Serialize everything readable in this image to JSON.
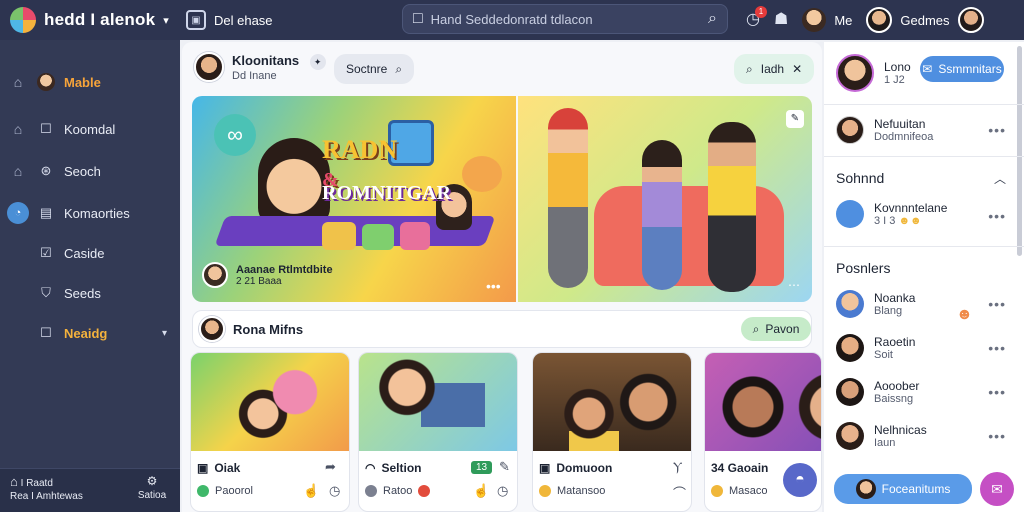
{
  "app": {
    "title": "hedd I alenok",
    "tab_label": "Del ehase",
    "search_placeholder": "Hand Seddedonratd tdlacon",
    "notification_count": "1",
    "user_short": "Me",
    "user_name": "Gedmes"
  },
  "sidebar": {
    "items": [
      {
        "label": "Mable",
        "icon": "avatar-icon",
        "lead": "home-icon"
      },
      {
        "label": "Koomdal",
        "icon": "square-icon",
        "lead": "home-icon"
      },
      {
        "label": "Seoch",
        "icon": "globe-icon",
        "lead": "car-icon"
      },
      {
        "label": "Komaorties",
        "icon": "grid-icon",
        "lead": "bubble-icon"
      },
      {
        "label": "Caside",
        "icon": "check-square-icon"
      },
      {
        "label": "Seeds",
        "icon": "shield-icon"
      },
      {
        "label": "Neaidg",
        "icon": "square-icon"
      }
    ],
    "bottom": [
      {
        "icon": "home-icon",
        "line1": "I Raatd",
        "line2": "Rea I Amhtewas"
      },
      {
        "icon": "gear-icon",
        "line1": "",
        "line2": "Satioa"
      }
    ]
  },
  "main": {
    "header": {
      "title": "Kloonitans",
      "subtitle": "Dd Inane",
      "sort_label": "Soctnre",
      "filter_label": "Iadh"
    },
    "hero": {
      "title_line1": "RADN",
      "title_amp": "&",
      "title_line2": "ROMNITGAR",
      "caption_name": "Aaanae Rtlmtdbite",
      "caption_sub": "2 21 Baaa"
    },
    "section": {
      "title": "Rona Mifns",
      "button_label": "Pavon"
    },
    "cards": [
      {
        "title": "Oiak",
        "sub": "Paoorol"
      },
      {
        "title": "Seltion",
        "sub": "Ratoo",
        "badge": "13"
      },
      {
        "title": "Domuoon",
        "sub": "Matansoo"
      },
      {
        "title": "34 Gaoain",
        "sub": "Masaco"
      }
    ]
  },
  "right": {
    "profile": {
      "name": "Lono",
      "sub": "1 J2",
      "button": "Ssmmnitars"
    },
    "people_top": [
      {
        "name": "Nefuuitan",
        "sub": "Dodmnifeoa"
      }
    ],
    "section1": {
      "title": "Sohnnd"
    },
    "s1_items": [
      {
        "name": "Kovnnntelane",
        "sub": "3 I 3"
      }
    ],
    "section2": {
      "title": "Posnlers"
    },
    "s2_items": [
      {
        "name": "Noanka",
        "sub": "Blang"
      },
      {
        "name": "Raoetin",
        "sub": "Soit"
      },
      {
        "name": "Aooober",
        "sub": "Baissng"
      },
      {
        "name": "Nelhnicas",
        "sub": "Iaun"
      }
    ],
    "bottom_button": "Foceanitums"
  },
  "colors": {
    "sidebar": "#333a55",
    "topbar": "#2d3450",
    "accent": "#4f8fe0",
    "orange": "#f7a43a"
  }
}
